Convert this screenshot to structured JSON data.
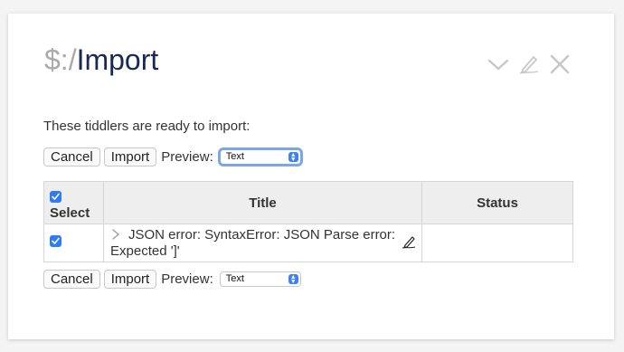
{
  "header": {
    "prefix": "$:/",
    "name": "Import",
    "icons": [
      "chevron-down-icon",
      "edit-icon",
      "close-icon"
    ]
  },
  "intro_text": "These tiddlers are ready to import:",
  "toolbar_top": {
    "cancel_label": "Cancel",
    "import_label": "Import",
    "preview_label": "Preview:",
    "preview_value": "Text"
  },
  "toolbar_bottom": {
    "cancel_label": "Cancel",
    "import_label": "Import",
    "preview_label": "Preview:",
    "preview_value": "Text"
  },
  "table": {
    "columns": {
      "select": "Select",
      "title": "Title",
      "status": "Status"
    },
    "select_all_checked": true,
    "rows": [
      {
        "checked": true,
        "title_line1": "JSON error: SyntaxError: JSON Parse error:",
        "title_line2": "Expected ']'",
        "status": ""
      }
    ]
  },
  "colors": {
    "title": "#182955",
    "prefix": "#aaaaaa",
    "accent": "#2f7bf5",
    "header_bg": "#eeeeee"
  }
}
